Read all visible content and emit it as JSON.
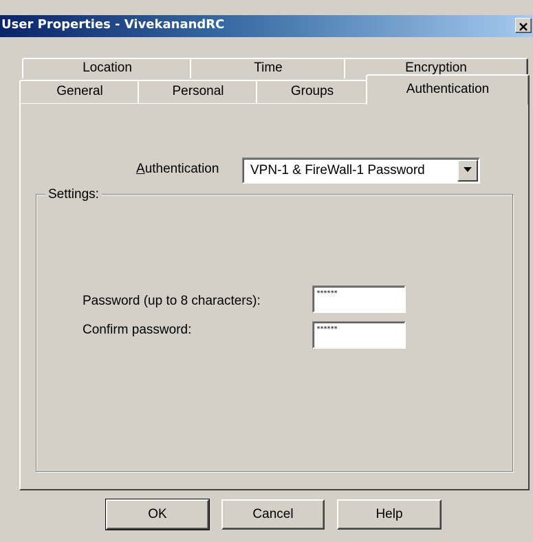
{
  "window": {
    "title": "User Properties - VivekanandRC",
    "close_glyph": "✕"
  },
  "tabs": {
    "back_row": [
      "Location",
      "Time",
      "Encryption"
    ],
    "front_row": [
      "General",
      "Personal",
      "Groups",
      "Authentication"
    ],
    "active": "Authentication"
  },
  "auth": {
    "label_accel": "A",
    "label_rest": "uthentication",
    "selected": "VPN-1 & FireWall-1 Password"
  },
  "settings": {
    "legend": "Settings:",
    "password_label": "Password (up to 8 characters):",
    "password_value": "******",
    "confirm_label": "Confirm password:",
    "confirm_value": "******"
  },
  "buttons": {
    "ok": "OK",
    "cancel": "Cancel",
    "help": "Help"
  }
}
